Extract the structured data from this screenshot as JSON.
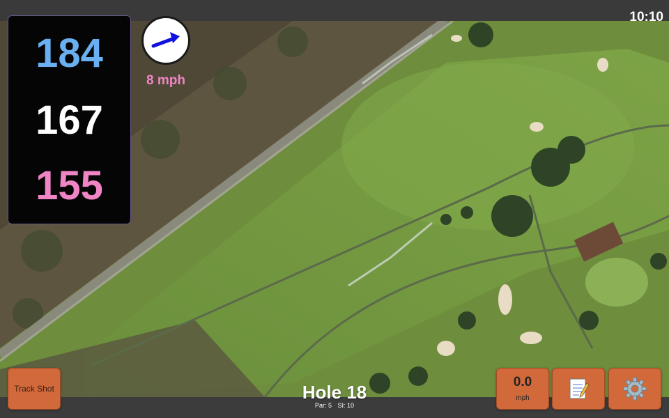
{
  "status_bar": {
    "time": "10:10"
  },
  "yardage": {
    "back": "184",
    "middle": "167",
    "front": "155",
    "colors": {
      "back": "#6aaff0",
      "middle": "#ffffff",
      "front": "#f085c5"
    }
  },
  "wind": {
    "speed_label": "8 mph",
    "direction_icon": "wind-direction-arrow-icon",
    "label_color": "#f085c5",
    "arrow_color": "#1010e0"
  },
  "hole": {
    "title": "Hole 18",
    "par": "Par: 5",
    "stroke_index": "SI: 10"
  },
  "buttons": {
    "track_shot": "Track Shot",
    "speed_value": "0.0",
    "speed_unit": "mph",
    "notes_icon": "notepad-icon",
    "settings_icon": "gear-icon",
    "accent_color": "#d2693a"
  }
}
